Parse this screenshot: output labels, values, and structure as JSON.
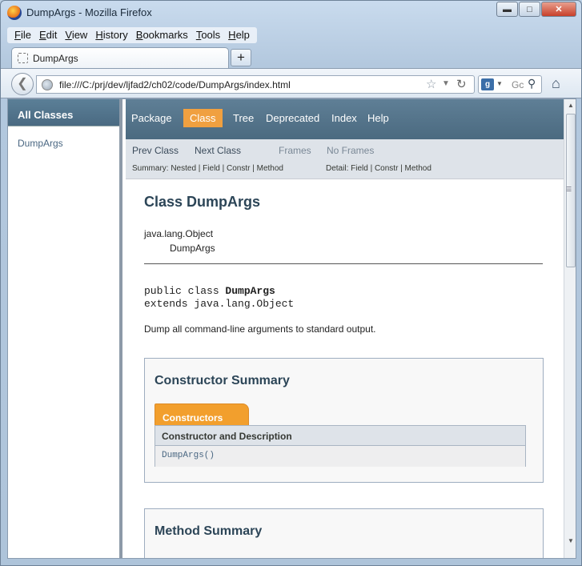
{
  "window": {
    "title": "DumpArgs - Mozilla Firefox"
  },
  "menu": [
    "File",
    "Edit",
    "View",
    "History",
    "Bookmarks",
    "Tools",
    "Help"
  ],
  "tab": {
    "label": "DumpArgs",
    "new_tab": "+"
  },
  "navbar": {
    "url": "file:///C:/prj/dev/ljfad2/ch02/code/DumpArgs/index.html",
    "search_text": "Gc"
  },
  "left": {
    "heading": "All Classes",
    "classes": [
      "DumpArgs"
    ]
  },
  "topnav": {
    "package": "Package",
    "class": "Class",
    "tree": "Tree",
    "deprecated": "Deprecated",
    "index": "Index",
    "help": "Help"
  },
  "subnav": {
    "prev": "Prev Class",
    "next": "Next Class",
    "frames": "Frames",
    "noframes": "No Frames",
    "summary": "Summary: Nested | Field | Constr | Method",
    "detail": "Detail: Field | Constr | Method"
  },
  "class": {
    "title": "Class DumpArgs",
    "inherit_parent": "java.lang.Object",
    "inherit_child": "DumpArgs",
    "decl_line1_prefix": "public class ",
    "decl_line1_name": "DumpArgs",
    "decl_line2": "extends java.lang.Object",
    "description": "Dump all command-line arguments to standard output."
  },
  "constructor_summary": {
    "title": "Constructor Summary",
    "tab": "Constructors",
    "header": "Constructor and Description",
    "row": "DumpArgs()"
  },
  "method_summary": {
    "title": "Method Summary"
  }
}
